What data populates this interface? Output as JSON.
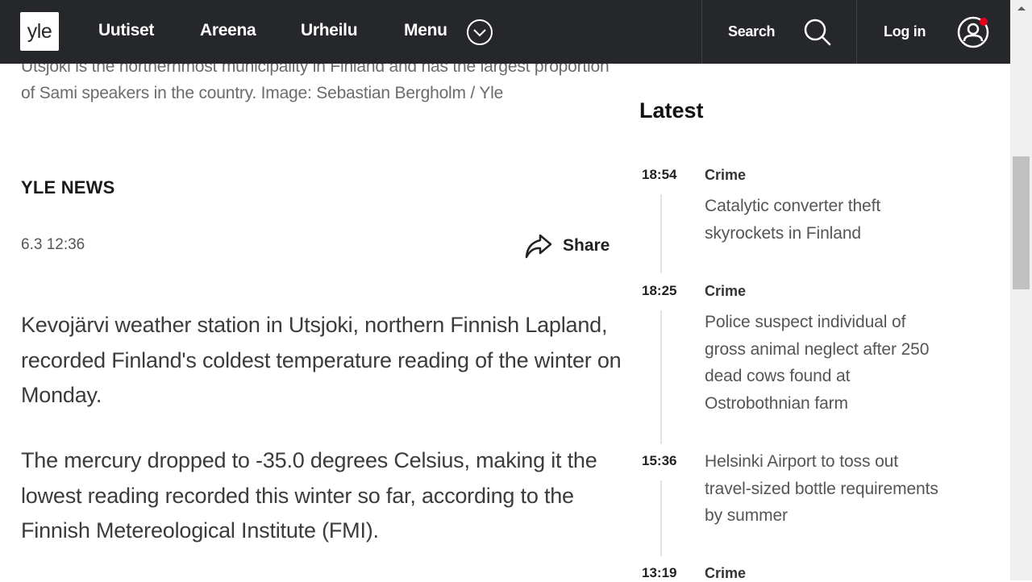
{
  "header": {
    "logo": "yle",
    "nav": [
      {
        "label": "Uutiset"
      },
      {
        "label": "Areena"
      },
      {
        "label": "Urheilu"
      },
      {
        "label": "Menu"
      }
    ],
    "search_label": "Search",
    "login_label": "Log in",
    "notification_color": "#e8001c",
    "background_color": "#25272a"
  },
  "article": {
    "image_caption": "Utsjoki is the northernmost municipality in Finland and has the largest proportion of Sami speakers in the country. Image: Sebastian Bergholm / Yle",
    "source": "YLE NEWS",
    "date": "6.3 12:36",
    "share_label": "Share",
    "paragraphs": [
      "Kevojärvi weather station in Utsjoki, northern Finnish Lapland, recorded Finland's coldest temperature reading of the winter on Monday.",
      "The mercury dropped to -35.0 degrees Celsius, making it the lowest reading recorded this winter so far, according to the Finnish Metereological Institute (FMI)."
    ]
  },
  "latest": {
    "title": "Latest",
    "items": [
      {
        "time": "18:54",
        "category": "Crime",
        "headline": "Catalytic converter theft skyrockets in Finland"
      },
      {
        "time": "18:25",
        "category": "Crime",
        "headline": "Police suspect individual of gross animal neglect after 250 dead cows found at Ostrobothnian farm"
      },
      {
        "time": "15:36",
        "category": "",
        "headline": "Helsinki Airport to toss out travel-sized bottle requirements by summer"
      },
      {
        "time": "13:19",
        "category": "Crime",
        "headline": ""
      }
    ]
  }
}
